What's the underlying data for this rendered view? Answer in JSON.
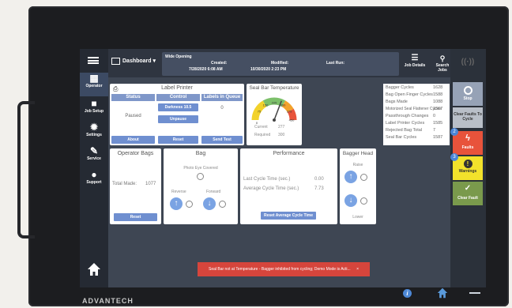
{
  "sidebar": {
    "items": [
      {
        "label": "Operator",
        "icon": "grid-icon"
      },
      {
        "label": "Job Setup",
        "icon": "briefcase-icon"
      },
      {
        "label": "Settings",
        "icon": "gear-icon"
      },
      {
        "label": "Service",
        "icon": "wrench-icon"
      },
      {
        "label": "Support",
        "icon": "support-icon"
      }
    ]
  },
  "header": {
    "dashboard_label": "Dashboard",
    "job_name": "Wide Opening",
    "created_label": "Created:",
    "created_value": "7/28/2020 6:08 AM",
    "modified_label": "Modified:",
    "modified_value": "10/30/2020 2:23 PM",
    "lastrun_label": "Last Run:",
    "job_details_label": "Job Details",
    "search_jobs_label": "Search Jobs"
  },
  "rail": {
    "stop_label": "Stop",
    "clear_faults_label": "Clear Faults To Cycle",
    "faults_label": "Faults",
    "faults_count": "2",
    "warnings_label": "Warnings",
    "warnings_count": "3",
    "clear_fault_label": "Clear Fault"
  },
  "label_printer": {
    "title": "Label Printer",
    "status_header": "Status",
    "control_header": "Control",
    "queue_header": "Labels in Queue",
    "status_value": "Paused",
    "darkness_label": "Darkness 10.5",
    "unpause_label": "Unpause",
    "queue_value": "0",
    "about_label": "About",
    "reset_label": "Reset",
    "send_test_label": "Send Test"
  },
  "seal_bar": {
    "title": "Seal Bar Temperature",
    "current_label": "Current",
    "current_value": "277",
    "required_label": "Required",
    "required_value": "300",
    "gauge_ticks": [
      "75",
      "150",
      "225",
      "300",
      "375",
      "450"
    ],
    "gauge_min": 0,
    "gauge_max": 450,
    "gauge_value": 277,
    "gauge_zero": "0"
  },
  "stats": {
    "rows": [
      {
        "label": "Bagger Cycles",
        "value": "1628"
      },
      {
        "label": "Bag Open Finger Cycles",
        "value": "1588"
      },
      {
        "label": "Bags Made",
        "value": "1088"
      },
      {
        "label": "Motorized Seal Flattener Cycles",
        "value": "1567"
      },
      {
        "label": "Passthrough Changes",
        "value": "0"
      },
      {
        "label": "Label Printer Cycles",
        "value": "1585"
      },
      {
        "label": "Rejected Bag Total",
        "value": "7"
      },
      {
        "label": "Seal Bar Cycles",
        "value": "1587"
      }
    ]
  },
  "operator_bags": {
    "title": "Operator Bags",
    "total_label": "Total Made:",
    "total_value": "1077",
    "reset_label": "Reset"
  },
  "bag": {
    "title": "Bag",
    "photo_eye_label": "Photo Eye Covered",
    "reverse_label": "Reverse",
    "forward_label": "Forward"
  },
  "performance": {
    "title": "Performance",
    "last_cycle_label": "Last Cycle Time (sec.)",
    "last_cycle_value": "0.00",
    "avg_cycle_label": "Average Cycle Time (sec.)",
    "avg_cycle_value": "7.73",
    "reset_avg_label": "Reset Average Cycle Time"
  },
  "bagger_head": {
    "title": "Bagger Head",
    "raise_label": "Raise",
    "lower_label": "Lower"
  },
  "banner": {
    "text": "Seal Bar not at Temperature - Bagger inhibited from cycling; Demo Mode is Acti..."
  },
  "device": {
    "brand": "ADVANTECH"
  },
  "colors": {
    "accent": "#6f8fd0",
    "fault": "#e8533b",
    "warning": "#f2e22b",
    "clear": "#7a9a4c",
    "banner": "#d6453c"
  }
}
